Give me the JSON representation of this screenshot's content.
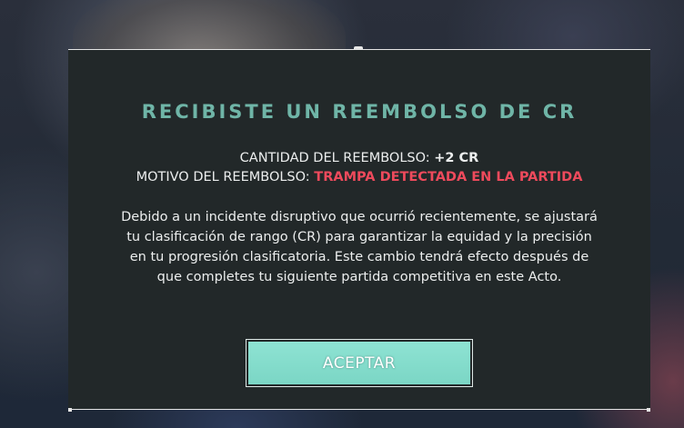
{
  "dialog": {
    "title": "RECIBISTE UN REEMBOLSO DE CR",
    "amount_label": "CANTIDAD DEL REEMBOLSO: ",
    "amount_value": "+2 CR",
    "reason_label": "MOTIVO DEL REEMBOLSO: ",
    "reason_value": "TRAMPA DETECTADA EN LA PARTIDA",
    "description": "Debido a un incidente disruptivo que ocurrió recientemente, se ajustará tu clasificación de rango (CR) para garantizar la equidad y la precisión en tu progresión clasificatoria. Este cambio tendrá efecto después de que completes tu siguiente partida competitiva en este Acto.",
    "accept_label": "ACEPTAR"
  },
  "colors": {
    "title": "#6fb5a7",
    "reason_highlight": "#ee4a5c",
    "button_fill": "#8ee3d3",
    "panel": "#222829"
  },
  "icons": {
    "grip_left": "drag-grip-icon",
    "grip_right": "drag-grip-icon"
  }
}
